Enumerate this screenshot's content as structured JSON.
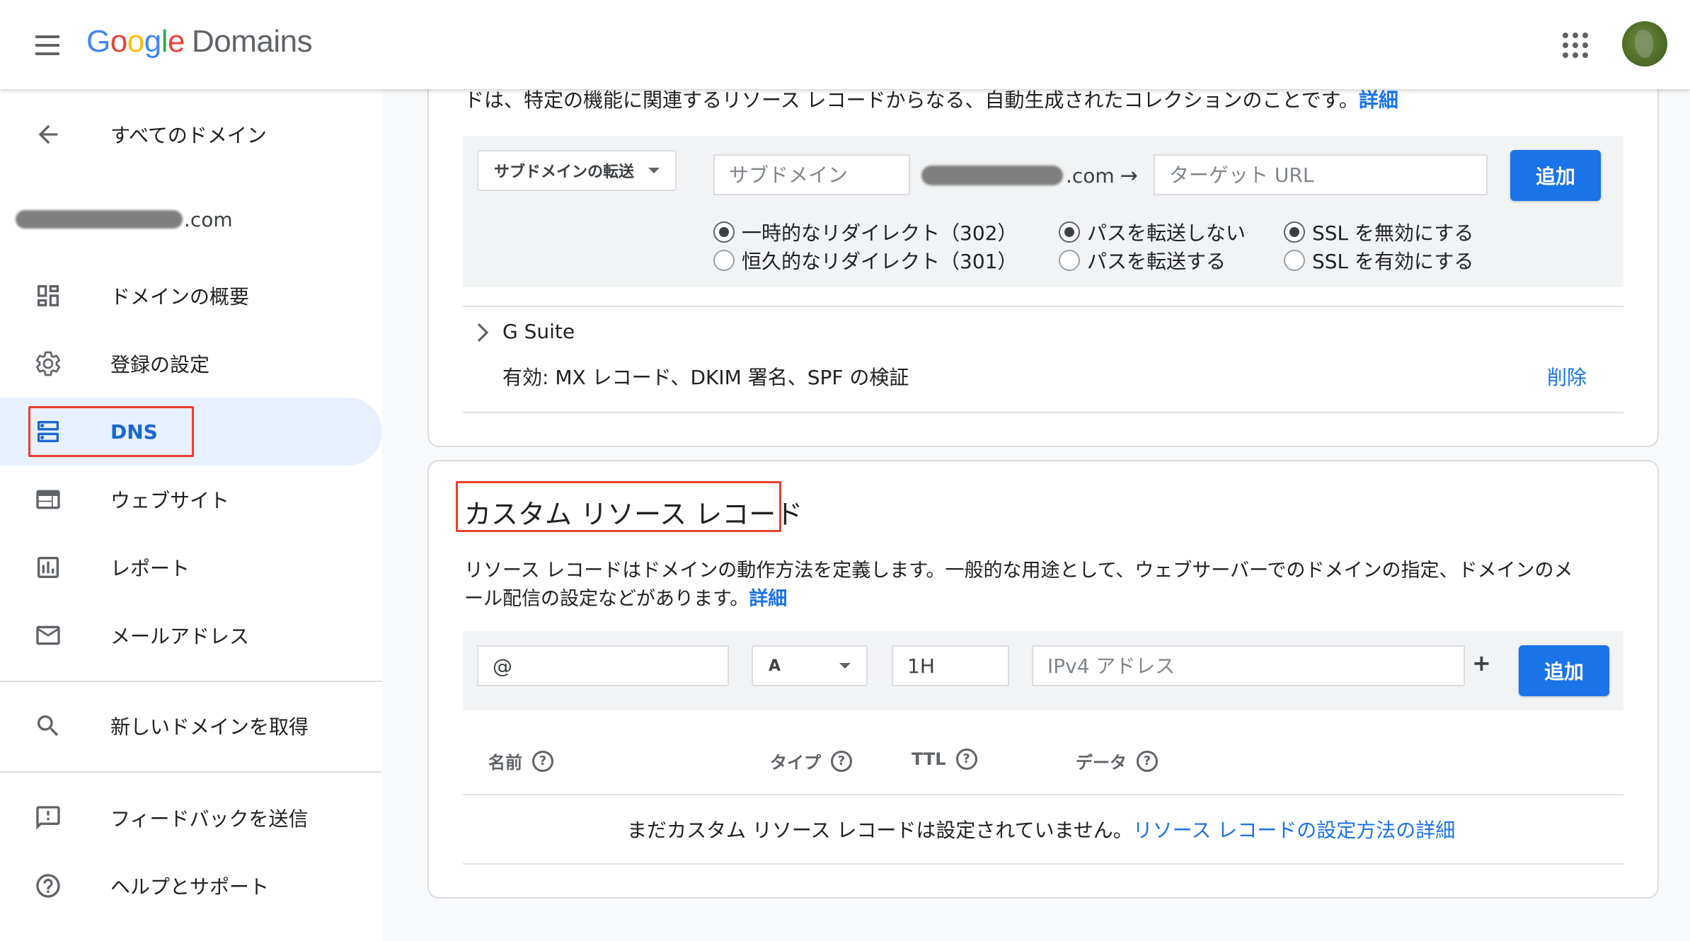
{
  "header": {
    "logo_google": [
      "G",
      "o",
      "o",
      "g",
      "l",
      "e"
    ],
    "logo_product": "Domains",
    "icons": {
      "menu": "hamburger-menu-icon",
      "apps": "apps-grid-icon",
      "avatar": "account-avatar"
    }
  },
  "sidebar": {
    "back_label": "すべてのドメイン",
    "domain_tld": ".com",
    "items": [
      {
        "label": "ドメインの概要",
        "icon": "dashboard-icon"
      },
      {
        "label": "登録の設定",
        "icon": "gear-icon"
      },
      {
        "label": "DNS",
        "icon": "dns-icon",
        "active": true
      },
      {
        "label": "ウェブサイト",
        "icon": "web-icon"
      },
      {
        "label": "レポート",
        "icon": "report-icon"
      },
      {
        "label": "メールアドレス",
        "icon": "mail-icon"
      }
    ],
    "get_domain_label": "新しいドメインを取得",
    "feedback_label": "フィードバックを送信",
    "help_label": "ヘルプとサポート"
  },
  "forwarding": {
    "intro_text": "ドは、特定の機能に関連するリソース レコードからなる、自動生成されたコレクションのことです。",
    "intro_link": "詳細",
    "type_dropdown": "サブドメインの転送",
    "subdomain_placeholder": "サブドメイン",
    "domain_suffix": ".com",
    "arrow": "→",
    "target_placeholder": "ターゲット URL",
    "add_button": "追加",
    "radio_redirect": [
      {
        "label": "一時的なリダイレクト（302）",
        "checked": true
      },
      {
        "label": "恒久的なリダイレクト（301）",
        "checked": false
      }
    ],
    "radio_path": [
      {
        "label": "パスを転送しない",
        "checked": true
      },
      {
        "label": "パスを転送する",
        "checked": false
      }
    ],
    "radio_ssl": [
      {
        "label": "SSL を無効にする",
        "checked": true
      },
      {
        "label": "SSL を有効にする",
        "checked": false
      }
    ]
  },
  "gsuite": {
    "title": "G Suite",
    "status": "有効: MX レコード、DKIM 署名、SPF の検証",
    "delete": "削除"
  },
  "custom_records": {
    "title": "カスタム リソース レコード",
    "description_line1": "リソース レコードはドメインの動作方法を定義します。一般的な用途として、ウェブサーバーでのドメインの指定、ドメインのメ",
    "description_line2": "ール配信の設定などがあります。",
    "description_link": "詳細",
    "name_value": "@",
    "type_value": "A",
    "ttl_value": "1H",
    "data_placeholder": "IPv4 アドレス",
    "plus": "+",
    "add_button": "追加",
    "columns": [
      "名前",
      "タイプ",
      "TTL",
      "データ"
    ],
    "empty_text": "まだカスタム リソース レコードは設定されていません。",
    "empty_link": "リソース レコードの設定方法の詳細"
  },
  "colors": {
    "accent": "#1a73e8",
    "highlight": "#e8402c",
    "active_bg": "#e8f0fe"
  }
}
